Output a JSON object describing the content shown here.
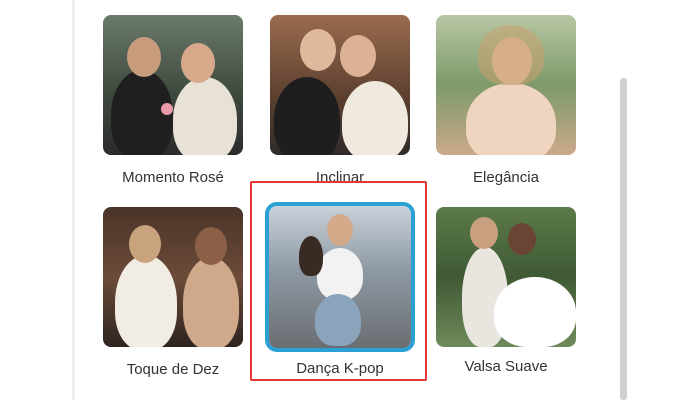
{
  "styles": [
    {
      "label": "Momento Rosé",
      "icon": "couple-rose-photo"
    },
    {
      "label": "Inclinar",
      "icon": "two-women-photo"
    },
    {
      "label": "Elegância",
      "icon": "woman-portrait-photo"
    },
    {
      "label": "Toque de Dez",
      "icon": "two-women-cafe-photo"
    },
    {
      "label": "Dança K-pop",
      "icon": "woman-dancing-street-photo",
      "selected": true
    },
    {
      "label": "Valsa Suave",
      "icon": "wedding-couple-photo"
    }
  ],
  "colors": {
    "selected_border": "#2aa0d4",
    "highlight_frame": "#e53935"
  }
}
